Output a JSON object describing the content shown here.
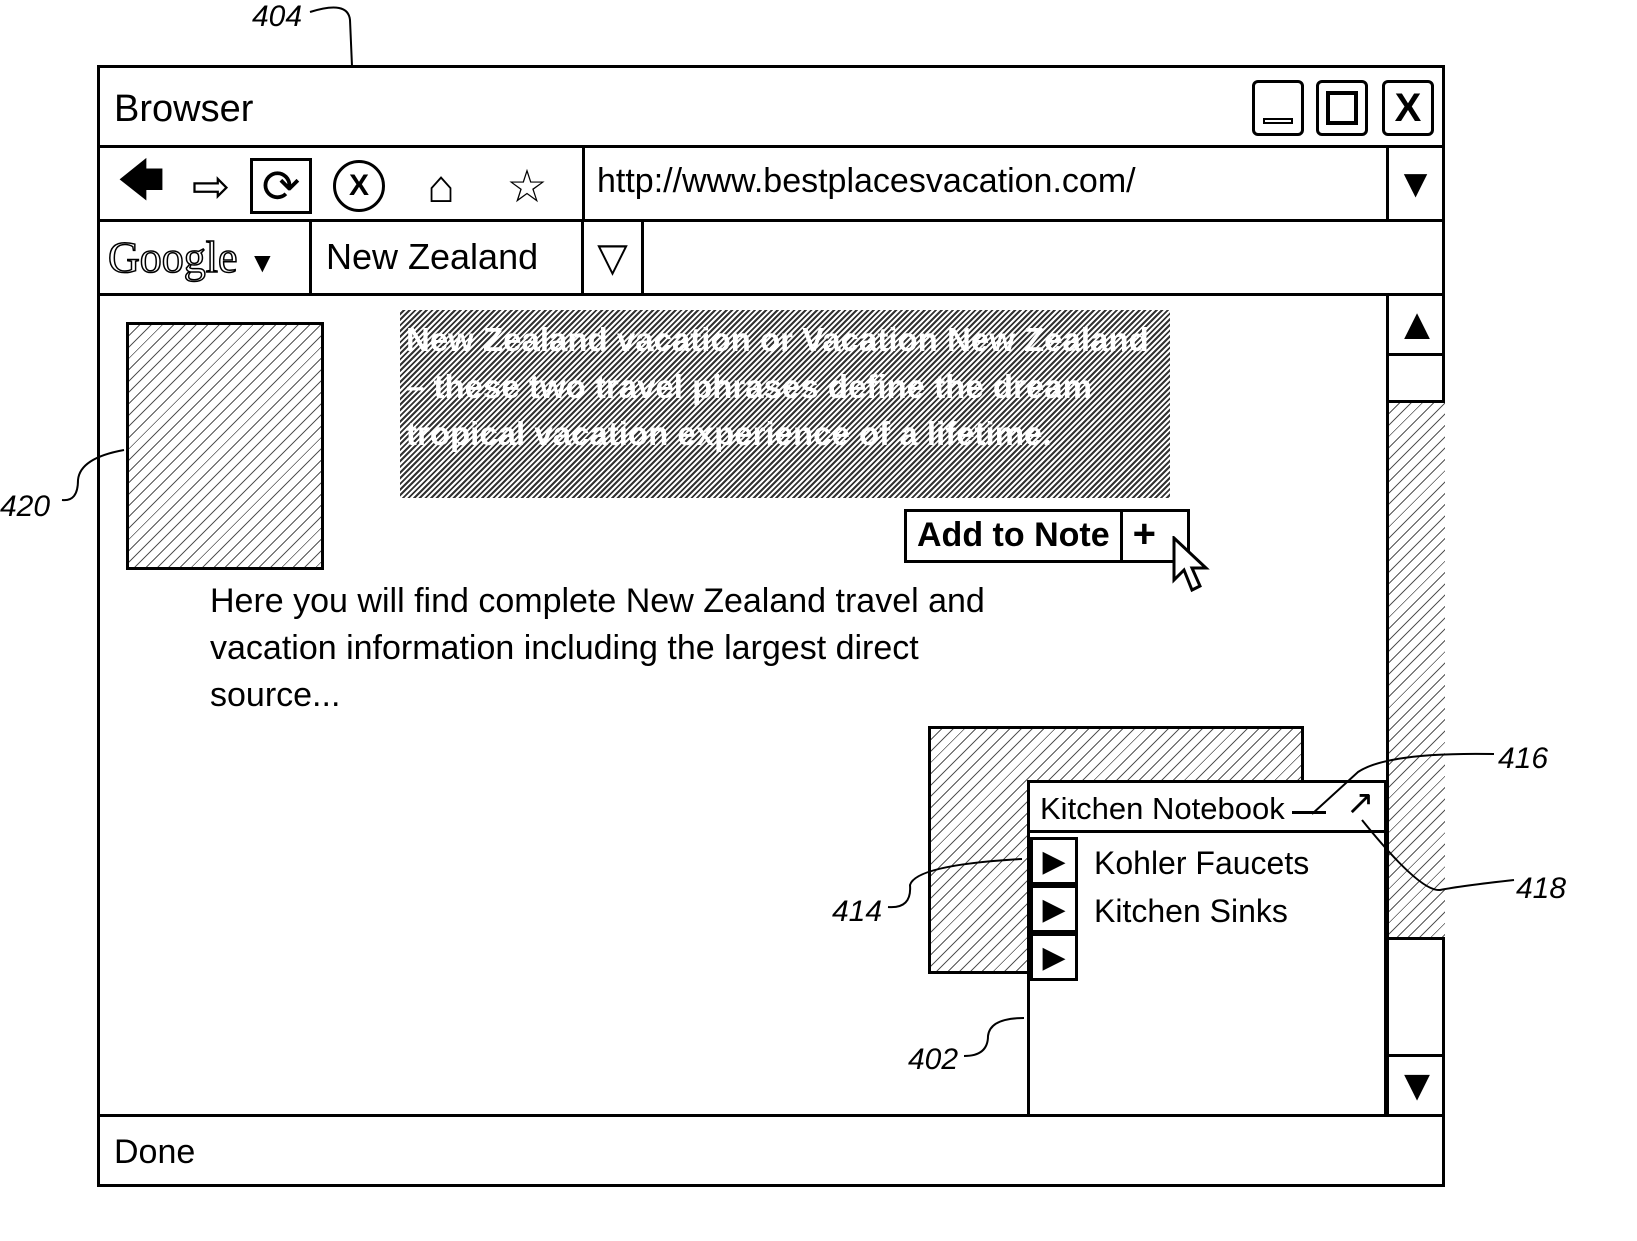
{
  "refs": {
    "window": "404",
    "image": "420",
    "note_panel": "402",
    "arrows": "414",
    "minimize": "416",
    "expand": "418"
  },
  "window": {
    "title": "Browser",
    "min_icon": "minimize-icon",
    "max_icon": "maximize-icon",
    "close_label": "X"
  },
  "nav": {
    "url": "http://www.bestplacesvacation.com/",
    "stop_label": "X"
  },
  "search": {
    "engine": "Google",
    "query": "New Zealand"
  },
  "content": {
    "highlighted": "New Zealand vacation or Vacation New Zealand – these two travel phrases define the dream tropical vacation experience of a lifetime.",
    "add_to_note": "Add to Note",
    "add_plus": "+",
    "paragraph": "Here you will find complete New Zealand travel and vacation information including the largest direct source..."
  },
  "notebook": {
    "title": "Kitchen Notebook",
    "items": [
      "Kohler Faucets",
      "Kitchen Sinks",
      ""
    ]
  },
  "status": "Done"
}
